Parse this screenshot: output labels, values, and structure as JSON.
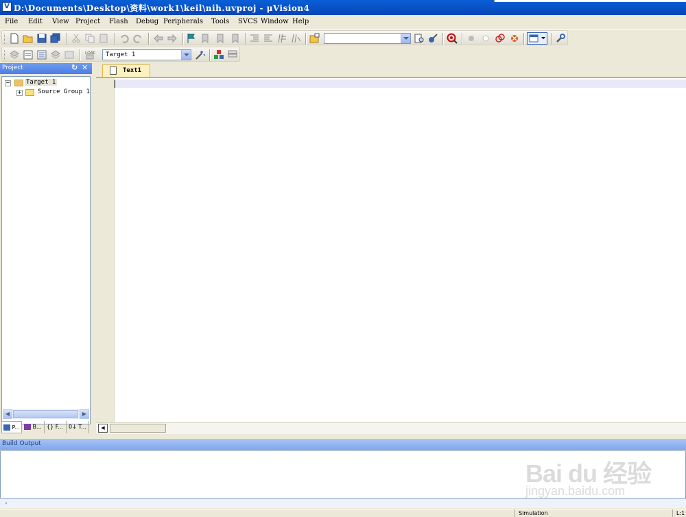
{
  "window": {
    "title": "D:\\Documents\\Desktop\\资料\\work1\\keil\\nih.uvproj - μVision4"
  },
  "menu": [
    "File",
    "Edit",
    "View",
    "Project",
    "Flash",
    "Debug",
    "Peripherals",
    "Tools",
    "SVCS",
    "Window",
    "Help"
  ],
  "toolbar": {
    "find_combo_value": "",
    "target_combo_value": "Target 1"
  },
  "project_panel": {
    "title": "Project",
    "tree": [
      {
        "label": "Target 1"
      },
      {
        "label": "Source Group 1"
      }
    ],
    "tabs": [
      {
        "label": "P..."
      },
      {
        "label": "B..."
      },
      {
        "label": "{} F..."
      },
      {
        "label": "0↓ T..."
      }
    ]
  },
  "editor": {
    "tab_label": "Text1"
  },
  "build_output": {
    "title": "Build Output"
  },
  "statusbar": {
    "mode": "Simulation",
    "position": "L:1"
  },
  "watermark": {
    "main": "Bai du 经验",
    "sub": "jingyan.baidu.com"
  },
  "colors": {
    "title_bar": "#0a5fd6",
    "panel_header": "#4c7ee4",
    "editor_tab": "#fcf2c0",
    "accent_orange": "#e8a63a"
  }
}
